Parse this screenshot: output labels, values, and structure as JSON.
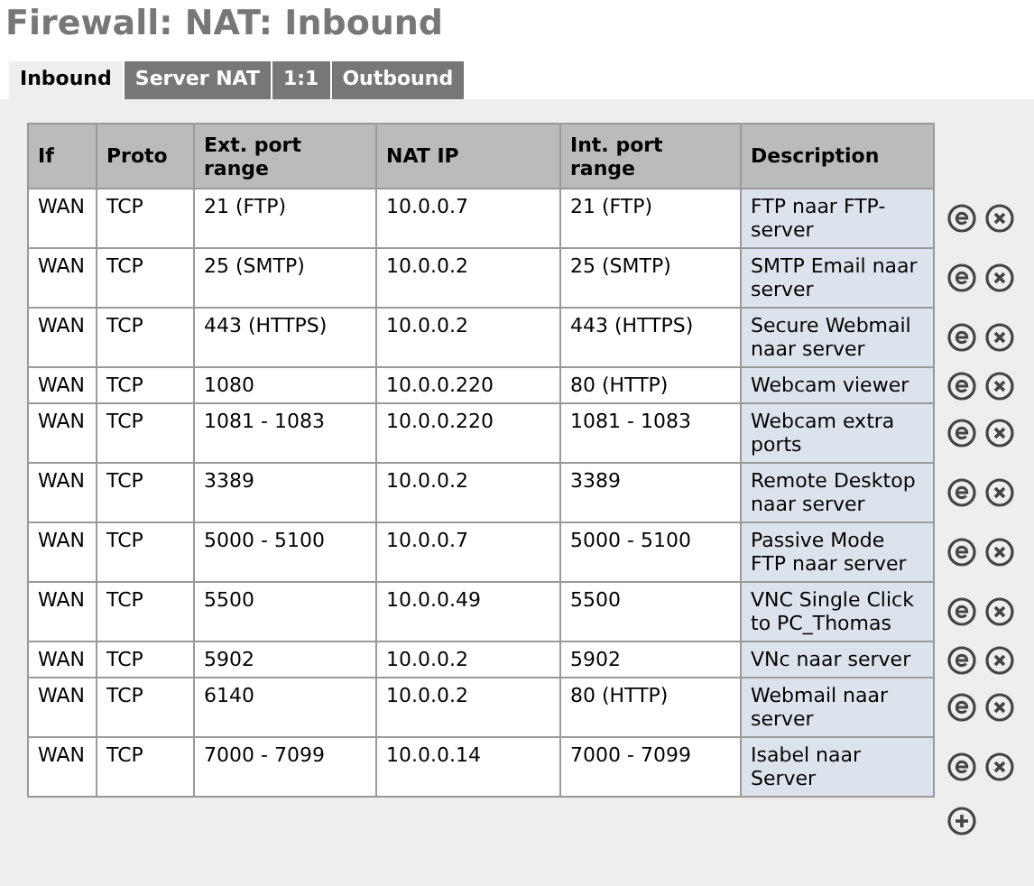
{
  "title": "Firewall: NAT: Inbound",
  "tabs": [
    {
      "label": "Inbound",
      "selected": true
    },
    {
      "label": "Server NAT",
      "selected": false
    },
    {
      "label": "1:1",
      "selected": false
    },
    {
      "label": "Outbound",
      "selected": false
    }
  ],
  "table": {
    "columns": [
      "If",
      "Proto",
      "Ext. port range",
      "NAT IP",
      "Int. port range",
      "Description"
    ],
    "rows": [
      [
        "WAN",
        "TCP",
        "21 (FTP)",
        "10.0.0.7",
        "21 (FTP)",
        "FTP naar FTP-server"
      ],
      [
        "WAN",
        "TCP",
        "25 (SMTP)",
        "10.0.0.2",
        "25 (SMTP)",
        "SMTP Email naar server"
      ],
      [
        "WAN",
        "TCP",
        "443 (HTTPS)",
        "10.0.0.2",
        "443 (HTTPS)",
        "Secure Webmail naar server"
      ],
      [
        "WAN",
        "TCP",
        "1080",
        "10.0.0.220",
        "80 (HTTP)",
        "Webcam viewer"
      ],
      [
        "WAN",
        "TCP",
        "1081 - 1083",
        "10.0.0.220",
        "1081 - 1083",
        "Webcam extra ports"
      ],
      [
        "WAN",
        "TCP",
        "3389",
        "10.0.0.2",
        "3389",
        "Remote Desktop naar server"
      ],
      [
        "WAN",
        "TCP",
        "5000 - 5100",
        "10.0.0.7",
        "5000 - 5100",
        "Passive Mode FTP naar server"
      ],
      [
        "WAN",
        "TCP",
        "5500",
        "10.0.0.49",
        "5500",
        "VNC Single Click to PC_Thomas"
      ],
      [
        "WAN",
        "TCP",
        "5902",
        "10.0.0.2",
        "5902",
        "VNc naar server"
      ],
      [
        "WAN",
        "TCP",
        "6140",
        "10.0.0.2",
        "80 (HTTP)",
        "Webmail naar server"
      ],
      [
        "WAN",
        "TCP",
        "7000 - 7099",
        "10.0.0.14",
        "7000 - 7099",
        "Isabel naar Server"
      ]
    ]
  }
}
